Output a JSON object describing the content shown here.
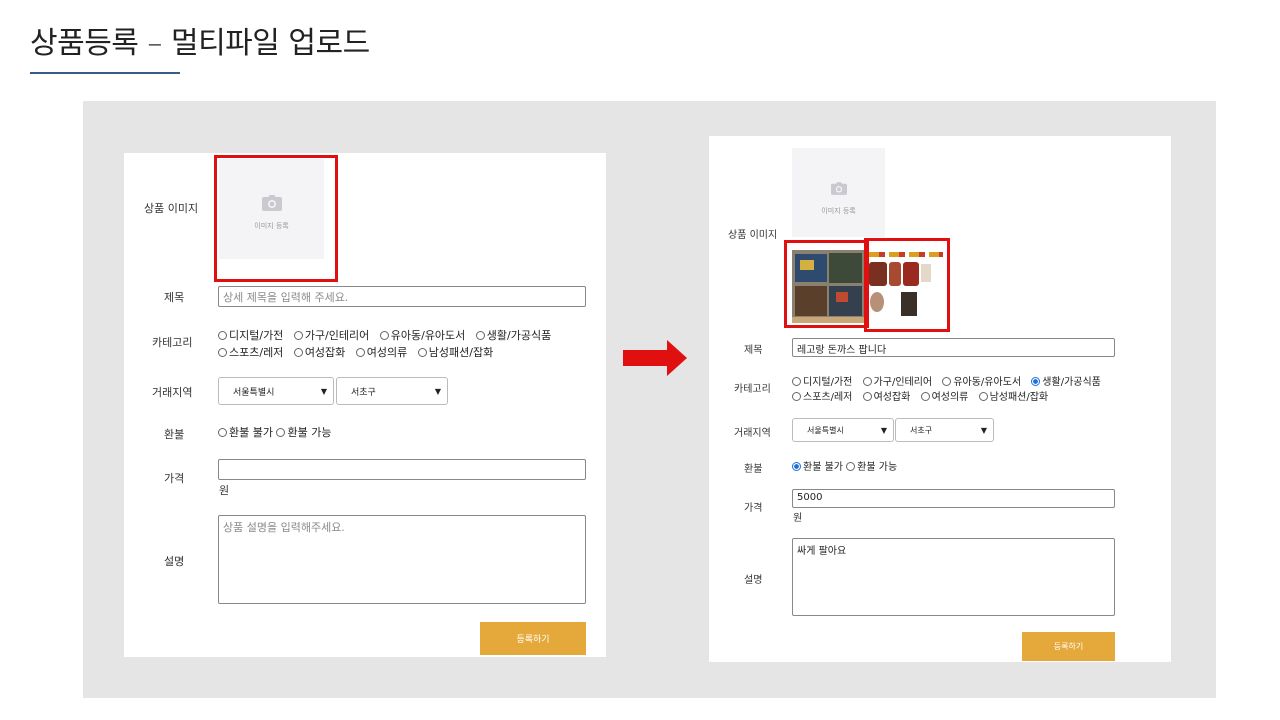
{
  "slide": {
    "title": "상품등록 – 멀티파일 업로드"
  },
  "colors": {
    "accent_button": "#e5a93b",
    "highlight_box": "#e01010",
    "arrow": "#e01010",
    "panel_bg": "#e6e5e5"
  },
  "form_before": {
    "image_label": "상품 이미지",
    "image_caption": "이미지 등록",
    "title_label": "제목",
    "title_placeholder": "상세 제목을 입력해 주세요.",
    "category_label": "카테고리",
    "category_row1": [
      "디지털/가전",
      "가구/인테리어",
      "유아동/유아도서",
      "생활/가공식품"
    ],
    "category_row2": [
      "스포츠/레저",
      "여성잡화",
      "여성의류",
      "남성패션/잡화"
    ],
    "region_label": "거래지역",
    "city_value": "서울특별시",
    "district_value": "서초구",
    "refund_label": "환불",
    "refund_options": [
      "환불 불가",
      "환불 가능"
    ],
    "price_label": "가격",
    "price_value": "",
    "price_unit": "원",
    "desc_label": "설명",
    "desc_placeholder": "상품 설명을 입력해주세요.",
    "submit_label": "등록하기"
  },
  "form_after": {
    "image_label": "상품 이미지",
    "image_caption": "이미지 등록",
    "title_label": "제목",
    "title_value": "레고랑 돈까스 팝니다",
    "category_label": "카테고리",
    "category_row1": [
      "디지털/가전",
      "가구/인테리어",
      "유아동/유아도서",
      "생활/가공식품"
    ],
    "category_row2": [
      "스포츠/레저",
      "여성잡화",
      "여성의류",
      "남성패션/잡화"
    ],
    "category_selected": "생활/가공식품",
    "region_label": "거래지역",
    "city_value": "서울특별시",
    "district_value": "서초구",
    "refund_label": "환불",
    "refund_options": [
      "환불 불가",
      "환불 가능"
    ],
    "refund_selected": "환불 불가",
    "price_label": "가격",
    "price_value": "5000",
    "price_unit": "원",
    "desc_label": "설명",
    "desc_value": "싸게 팔아요",
    "submit_label": "등록하기"
  }
}
